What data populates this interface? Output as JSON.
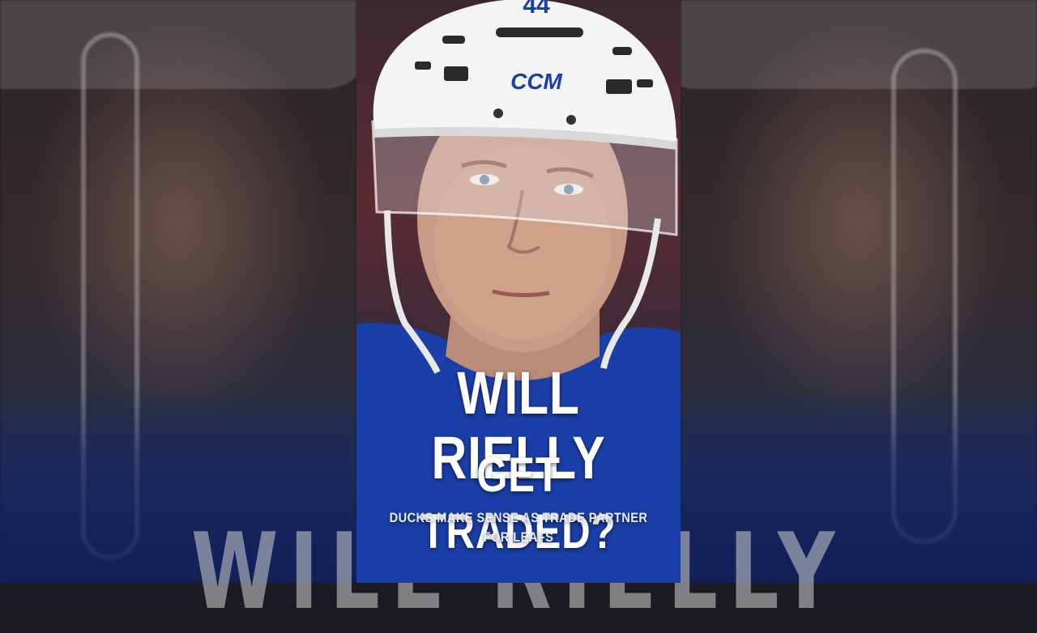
{
  "headline": {
    "line1": "WILL RIELLY",
    "line2": "GET TRADED?",
    "subtitle": "DUCKS MAKE SENSE AS TRADE PARTNER FOR LEAFS"
  },
  "helmet": {
    "number": "44",
    "brand": "CCM"
  },
  "background_ghost_text": "WILL RIELLY",
  "colors": {
    "helmet_white": "#f4f4f4",
    "leafs_blue": "#1b3fa8",
    "text_white": "#ffffff"
  }
}
